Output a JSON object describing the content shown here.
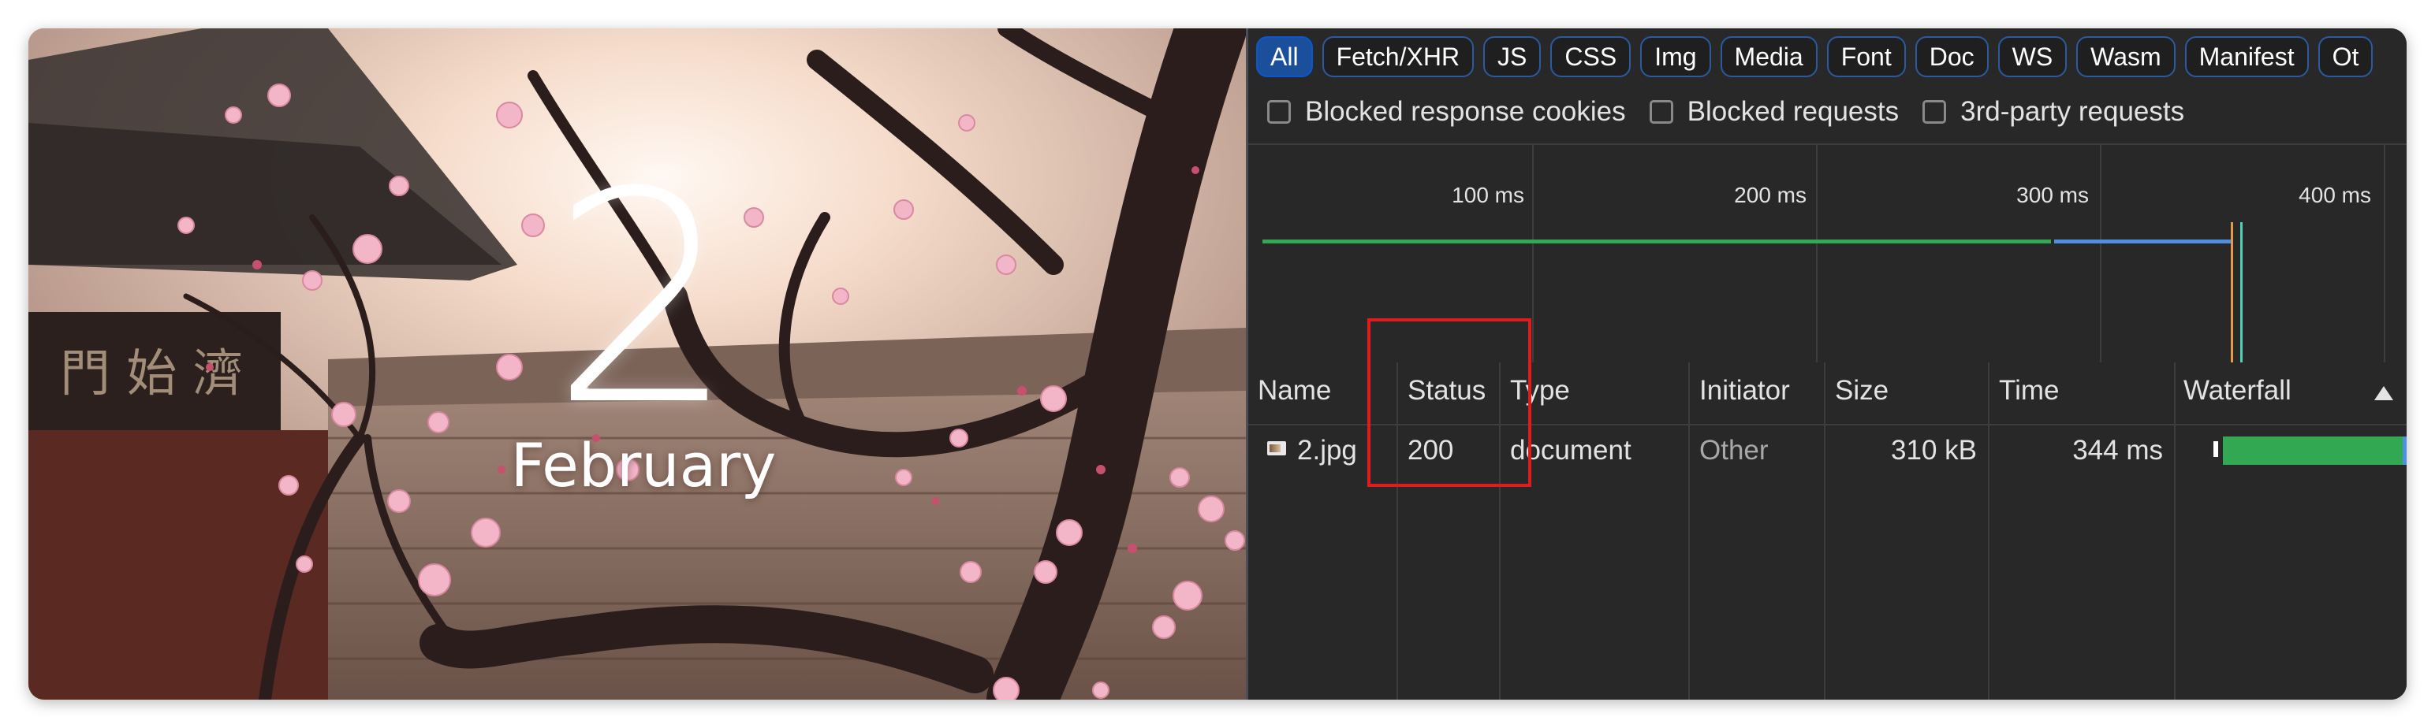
{
  "photo": {
    "day": "2",
    "month": "February"
  },
  "devtools": {
    "filters": [
      "All",
      "Fetch/XHR",
      "JS",
      "CSS",
      "Img",
      "Media",
      "Font",
      "Doc",
      "WS",
      "Wasm",
      "Manifest",
      "Ot"
    ],
    "active_filter": "All",
    "checkboxes": [
      "Blocked response cookies",
      "Blocked requests",
      "3rd-party requests"
    ],
    "timeline_ticks": [
      "100 ms",
      "200 ms",
      "300 ms",
      "400 ms"
    ],
    "columns": [
      "Name",
      "Status",
      "Type",
      "Initiator",
      "Size",
      "Time",
      "Waterfall"
    ],
    "rows": [
      {
        "name": "2.jpg",
        "status": "200",
        "type": "document",
        "initiator": "Other",
        "size": "310 kB",
        "time": "344 ms"
      }
    ],
    "highlight_color": "#e01b1b"
  }
}
